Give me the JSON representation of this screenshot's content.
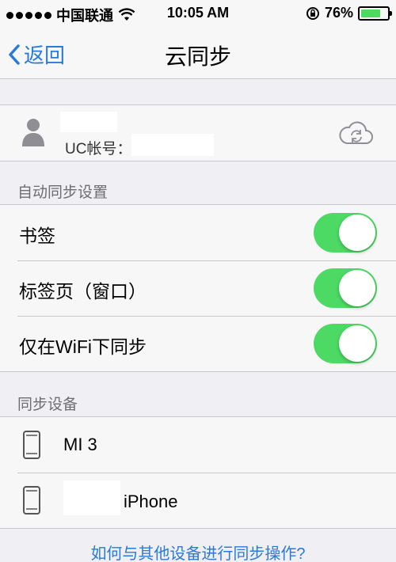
{
  "status_bar": {
    "carrier": "中国联通",
    "time": "10:05 AM",
    "battery_percent": "76%",
    "battery_level": 0.76,
    "icons": [
      "signal-icon",
      "wifi-icon",
      "rotation-lock-icon",
      "battery-icon"
    ]
  },
  "nav": {
    "back_label": "返回",
    "title": "云同步"
  },
  "account": {
    "uc_label": "UC帐号："
  },
  "sections": {
    "auto_sync": "自动同步设置",
    "devices": "同步设备"
  },
  "settings": [
    {
      "label": "书签",
      "on": true
    },
    {
      "label": "标签页（窗口）",
      "on": true
    },
    {
      "label": "仅在WiFi下同步",
      "on": true
    }
  ],
  "devices": [
    {
      "name": "MI 3"
    },
    {
      "name": "iPhone"
    }
  ],
  "help_link": "如何与其他设备进行同步操作?",
  "colors": {
    "accent": "#2a7bd8",
    "toggle_on": "#4cd964",
    "background": "#efeff4"
  }
}
